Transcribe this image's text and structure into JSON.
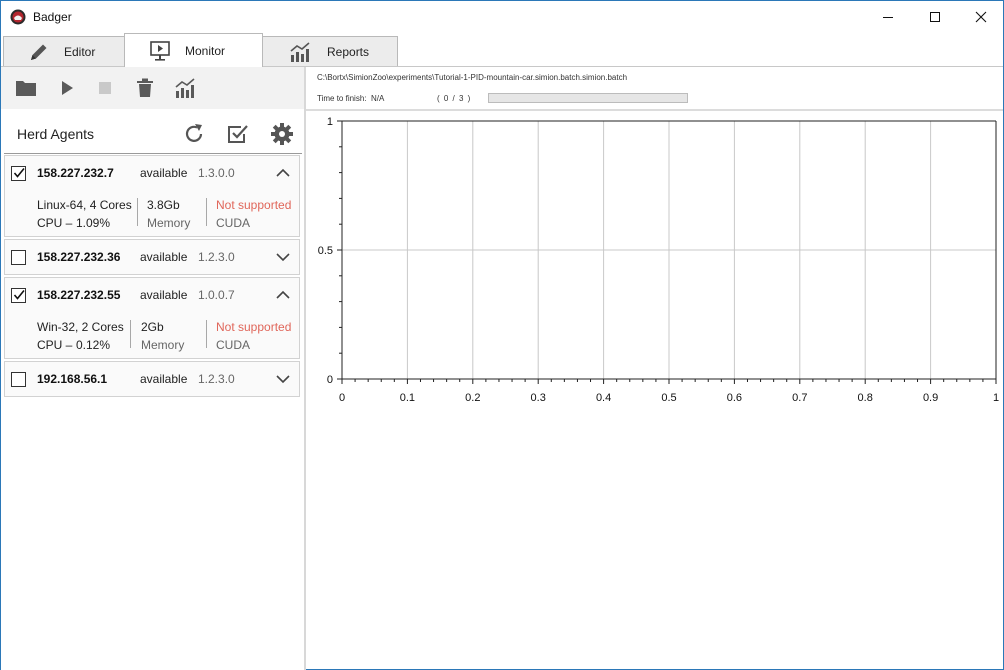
{
  "window": {
    "title": "Badger"
  },
  "tabs": [
    {
      "label": "Editor",
      "icon": "pencil-icon",
      "active": false
    },
    {
      "label": "Monitor",
      "icon": "monitor-icon",
      "active": true
    },
    {
      "label": "Reports",
      "icon": "reports-chart-icon",
      "active": false
    }
  ],
  "toolbar": {
    "buttons": [
      "folder-icon",
      "play-icon",
      "stop-icon",
      "trash-icon",
      "chart-icon"
    ]
  },
  "herd": {
    "title": "Herd Agents",
    "actions": [
      "refresh-icon",
      "select-all-icon",
      "settings-gear-icon"
    ],
    "agents": [
      {
        "ip": "158.227.232.7",
        "status": "available",
        "version": "1.3.0.0",
        "checked": true,
        "expanded": true,
        "os": "Linux-64, 4 Cores",
        "cpu_label": "CPU –",
        "cpu": "1.09%",
        "memory": "3.8Gb",
        "memory_label": "Memory",
        "cuda": "Not supported",
        "cuda_label": "CUDA"
      },
      {
        "ip": "158.227.232.36",
        "status": "available",
        "version": "1.2.3.0",
        "checked": false,
        "expanded": false
      },
      {
        "ip": "158.227.232.55",
        "status": "available",
        "version": "1.0.0.7",
        "checked": true,
        "expanded": true,
        "os": "Win-32, 2 Cores",
        "cpu_label": "CPU –",
        "cpu": "0.12%",
        "memory": "2Gb",
        "memory_label": "Memory",
        "cuda": "Not supported",
        "cuda_label": "CUDA"
      },
      {
        "ip": "192.168.56.1",
        "status": "available",
        "version": "1.2.3.0",
        "checked": false,
        "expanded": false
      }
    ]
  },
  "experiment": {
    "path": "C:\\Bortx\\SimionZoo\\experiments\\Tutorial-1-PID-mountain-car.simion.batch.simion.batch",
    "time_to_finish_label": "Time to finish:",
    "time_to_finish": "N/A",
    "progress_text": "( 0 / 3 )",
    "progress_fraction": 0
  },
  "chart_data": {
    "type": "line",
    "series": [],
    "xlim": [
      0,
      1
    ],
    "ylim": [
      0,
      1
    ],
    "x_ticks": [
      "0",
      "0.1",
      "0.2",
      "0.3",
      "0.4",
      "0.5",
      "0.6",
      "0.7",
      "0.8",
      "0.9",
      "1"
    ],
    "y_ticks": [
      "0",
      "0.5",
      "1"
    ],
    "grid": true
  },
  "colors": {
    "accent_red": "#e0665a",
    "progress_green": "#06b025",
    "window_border": "#2b78b8"
  }
}
